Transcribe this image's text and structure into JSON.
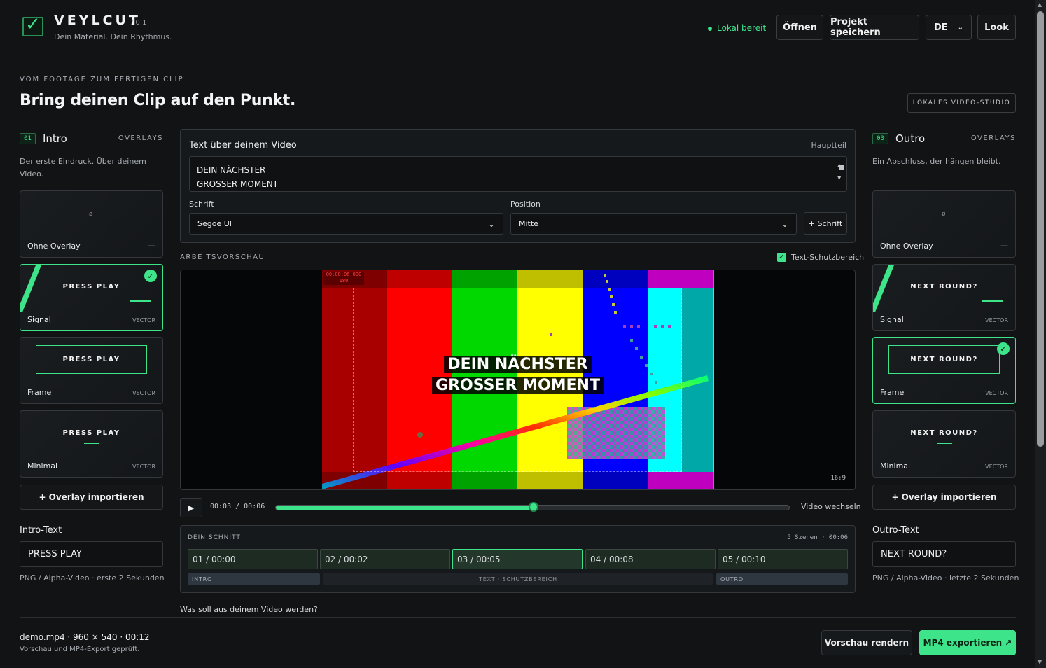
{
  "header": {
    "brand": "VEYLCUT",
    "version": "/ 0.1",
    "tagline": "Dein Material. Dein Rhythmus.",
    "status": "Lokal bereit",
    "buttons": {
      "open": "Öffnen",
      "save": "Projekt speichern",
      "lang": "DE",
      "look": "Look"
    }
  },
  "hero": {
    "eyebrow": "VOM FOOTAGE ZUM FERTIGEN CLIP",
    "title": "Bring deinen Clip auf den Punkt.",
    "badge": "LOKALES VIDEO-STUDIO"
  },
  "intro": {
    "num": "01",
    "title": "Intro",
    "overlays_label": "OVERLAYS",
    "desc_line1": "Der erste Eindruck. Über deinem",
    "desc_line2": "Video.",
    "cards": [
      {
        "name": "Ohne Overlay",
        "tag": "—",
        "text": "ø"
      },
      {
        "name": "Signal",
        "tag": "VECTOR",
        "text": "PRESS PLAY",
        "selected": true
      },
      {
        "name": "Frame",
        "tag": "VECTOR",
        "text": "PRESS PLAY"
      },
      {
        "name": "Minimal",
        "tag": "VECTOR",
        "text": "PRESS PLAY"
      }
    ],
    "import": "+ Overlay importieren",
    "text_label": "Intro-Text",
    "text_value": "PRESS PLAY",
    "note": "PNG / Alpha-Video · erste 2 Sekunden"
  },
  "outro": {
    "num": "03",
    "title": "Outro",
    "overlays_label": "OVERLAYS",
    "desc": "Ein Abschluss, der hängen bleibt.",
    "cards": [
      {
        "name": "Ohne Overlay",
        "tag": "—",
        "text": "ø"
      },
      {
        "name": "Signal",
        "tag": "VECTOR",
        "text": "NEXT ROUND?"
      },
      {
        "name": "Frame",
        "tag": "VECTOR",
        "text": "NEXT ROUND?",
        "selected": true
      },
      {
        "name": "Minimal",
        "tag": "VECTOR",
        "text": "NEXT ROUND?"
      }
    ],
    "import": "+ Overlay importieren",
    "text_label": "Outro-Text",
    "text_value": "NEXT ROUND?",
    "note": "PNG / Alpha-Video · letzte 2 Sekunden"
  },
  "main": {
    "text_title": "Text über deinem Video",
    "text_section": "Hauptteil",
    "text_line1": "DEIN NÄCHSTER",
    "text_line2": "GROSSER MOMENT",
    "font_label": "Schrift",
    "font_value": "Segoe UI",
    "position_label": "Position",
    "position_value": "Mitte",
    "add_font": "+ Schrift",
    "preview_label": "ARBEITSVORSCHAU",
    "safe_label": "Text-Schutzbereich",
    "timecode_line1": "00:00:06.000",
    "timecode_line2": "180",
    "overlay_line1": "DEIN NÄCHSTER",
    "overlay_line2": "GROSSER MOMENT",
    "ratio": "16:9",
    "time": "00:03 / 00:06",
    "progress": 0.5,
    "swap": "Video wechseln"
  },
  "colors": {
    "accent": "#3ee48a",
    "bars": [
      "#a80000",
      "#ff0000",
      "#00d800",
      "#ffff00",
      "#0000ff",
      "#ff00ff",
      "#00ffff"
    ]
  },
  "cut": {
    "title": "DEIN SCHNITT",
    "summary": "5 Szenen · 00:06",
    "scenes": [
      "01 / 00:00",
      "02 / 00:02",
      "03 / 00:05",
      "04 / 00:08",
      "05 / 00:10"
    ],
    "segments": [
      "INTRO",
      "TEXT · SCHUTZBEREICH",
      "OUTRO"
    ]
  },
  "footer": {
    "question": "Was soll aus deinem Video werden?",
    "file": "demo.mp4 · 960 × 540 · 00:12",
    "file_note": "Vorschau und MP4-Export geprüft.",
    "render": "Vorschau rendern",
    "export": "MP4 exportieren ↗"
  }
}
